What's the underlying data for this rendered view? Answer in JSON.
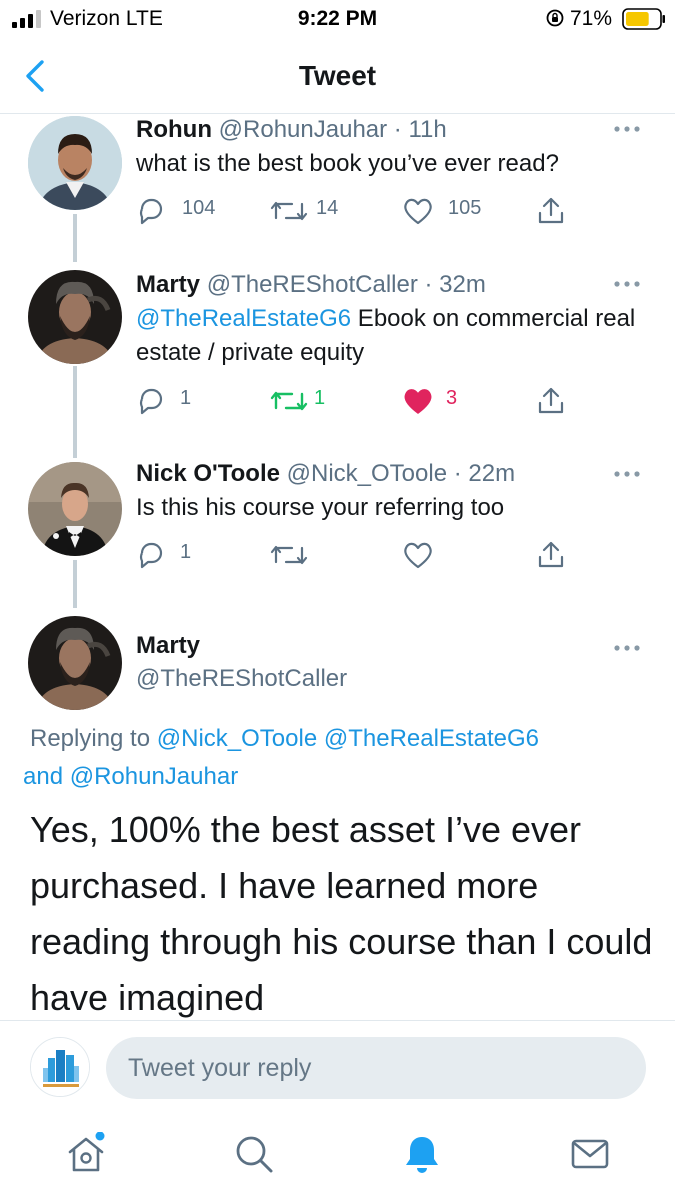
{
  "status_bar": {
    "carrier": "Verizon  LTE",
    "time": "9:22 PM",
    "battery": "71%",
    "battery_level": 0.71
  },
  "header": {
    "title": "Tweet",
    "back_icon": "chevron-left-icon"
  },
  "thread": [
    {
      "name": "Rohun",
      "handle": "@RohunJauhar",
      "dot": "·",
      "age": "11h",
      "text": "what is the best book you’ve ever read?",
      "reply_count": "104",
      "retweet_count": "14",
      "like_count": "105"
    },
    {
      "name": "Marty",
      "handle": "@TheREShotCaller",
      "dot": "·",
      "age": "32m",
      "mention": "@TheRealEstateG6",
      "text": " Ebook on commercial real estate / private equity",
      "reply_count": "1",
      "retweet_count": "1",
      "like_count": "3",
      "retweeted": true,
      "liked": true
    },
    {
      "name": "Nick O'Toole",
      "handle": "@Nick_OToole",
      "dot": "·",
      "age": "22m",
      "text": "Is this his course your referring too",
      "reply_count": "1",
      "retweet_count": "",
      "like_count": ""
    }
  ],
  "main_tweet": {
    "name": "Marty",
    "handle": "@TheREShotCaller",
    "replying_prefix": "Replying to ",
    "mention_1": "@Nick_OToole",
    "space": " ",
    "mention_2": "@TheRealEstateG6",
    "and": " and ",
    "mention_3": "@RohunJauhar",
    "text": "Yes, 100% the best asset I’ve ever purchased. I have learned more reading through his course than I could have imagined"
  },
  "reply_bar": {
    "placeholder": "Tweet your reply"
  },
  "tab_bar": [
    "home-icon",
    "search-icon",
    "notifications-icon",
    "messages-icon"
  ],
  "colors": {
    "accent": "#1da1f2",
    "retweet": "#17bf63",
    "like": "#e0245e",
    "secondary_text": "#5b7083"
  }
}
